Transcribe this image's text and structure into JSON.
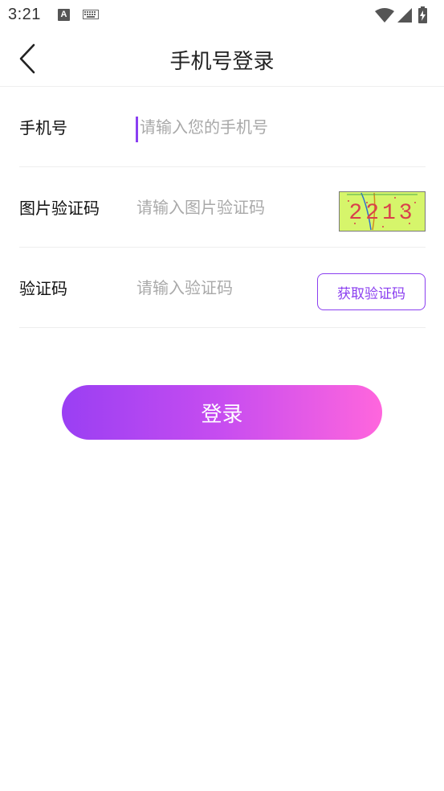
{
  "status_bar": {
    "time": "3:21",
    "a_icon_text": "A",
    "icons": [
      "a-icon",
      "keyboard-icon",
      "wifi-icon",
      "signal-icon",
      "battery-icon"
    ]
  },
  "header": {
    "title": "手机号登录",
    "back_icon": "chevron-left-icon"
  },
  "form": {
    "phone": {
      "label": "手机号",
      "placeholder": "请输入您的手机号",
      "value": ""
    },
    "image_captcha": {
      "label": "图片验证码",
      "placeholder": "请输入图片验证码",
      "value": "",
      "captcha_text": "2213"
    },
    "sms_code": {
      "label": "验证码",
      "placeholder": "请输入验证码",
      "value": "",
      "button_label": "获取验证码"
    }
  },
  "login_button": {
    "label": "登录"
  },
  "colors": {
    "accent": "#8b3ff0",
    "gradient_start": "#9a3ff3",
    "gradient_end": "#ff66dd",
    "captcha_bg": "#d6f56b",
    "captcha_text": "#d9414b"
  }
}
